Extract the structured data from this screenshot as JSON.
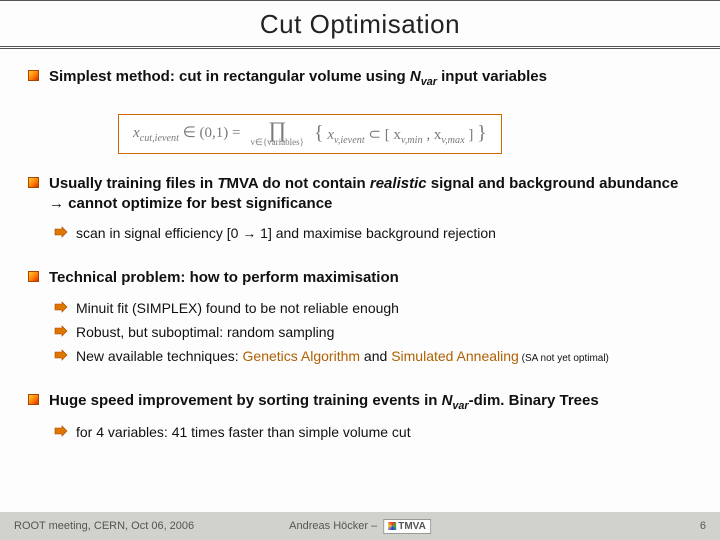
{
  "title": "Cut Optimisation",
  "bullets": {
    "b1_pre": "Simplest method: cut in rectangular volume using ",
    "b1_nvar": "N",
    "b1_nvar_sub": "var",
    "b1_post": " input variables",
    "formula_lhs": "x",
    "formula_lhs_sub": "cut,ievent",
    "formula_in": " ∈ (0,1)  =",
    "formula_op": "∏",
    "formula_under": "v∈{variables}",
    "formula_rhs_a": "x",
    "formula_rhs_a_sub": "v,ievent",
    "formula_rhs_mid": " ⊂ [ x",
    "formula_rhs_b_sub": "v,min",
    "formula_rhs_c": " , x",
    "formula_rhs_c_sub": "v,max",
    "formula_rhs_end": " ]",
    "b2_pre": "Usually training files in ",
    "b2_tmva_t": "T",
    "b2_tmva_rest": "MVA do not contain ",
    "b2_realistic": "realistic",
    "b2_post": " signal and background abundance → cannot optimize for best significance",
    "b2s1": "scan in signal efficiency [0 → 1] and maximise background rejection",
    "b3": "Technical problem: how to perform maximisation",
    "b3s1": "Minuit fit (SIMPLEX) found to be not reliable enough",
    "b3s2": "Robust, but suboptimal: random sampling",
    "b3s3_pre": "New available techniques: ",
    "b3s3_ga": "Genetics Algorithm",
    "b3s3_mid": " and ",
    "b3s3_sa": "Simulated Annealing",
    "b3s3_note": " (SA not yet optimal)",
    "b4_pre": "Huge speed improvement by sorting training events in ",
    "b4_nvar": "N",
    "b4_nvar_sub": "var",
    "b4_post": "-dim. Binary Trees",
    "b4s1": "for 4 variables: 41 times faster than simple volume cut"
  },
  "footer": {
    "left": "ROOT meeting, CERN, Oct 06, 2006",
    "author": "Andreas Höcker  –",
    "logo": "TMVA",
    "page": "6"
  }
}
